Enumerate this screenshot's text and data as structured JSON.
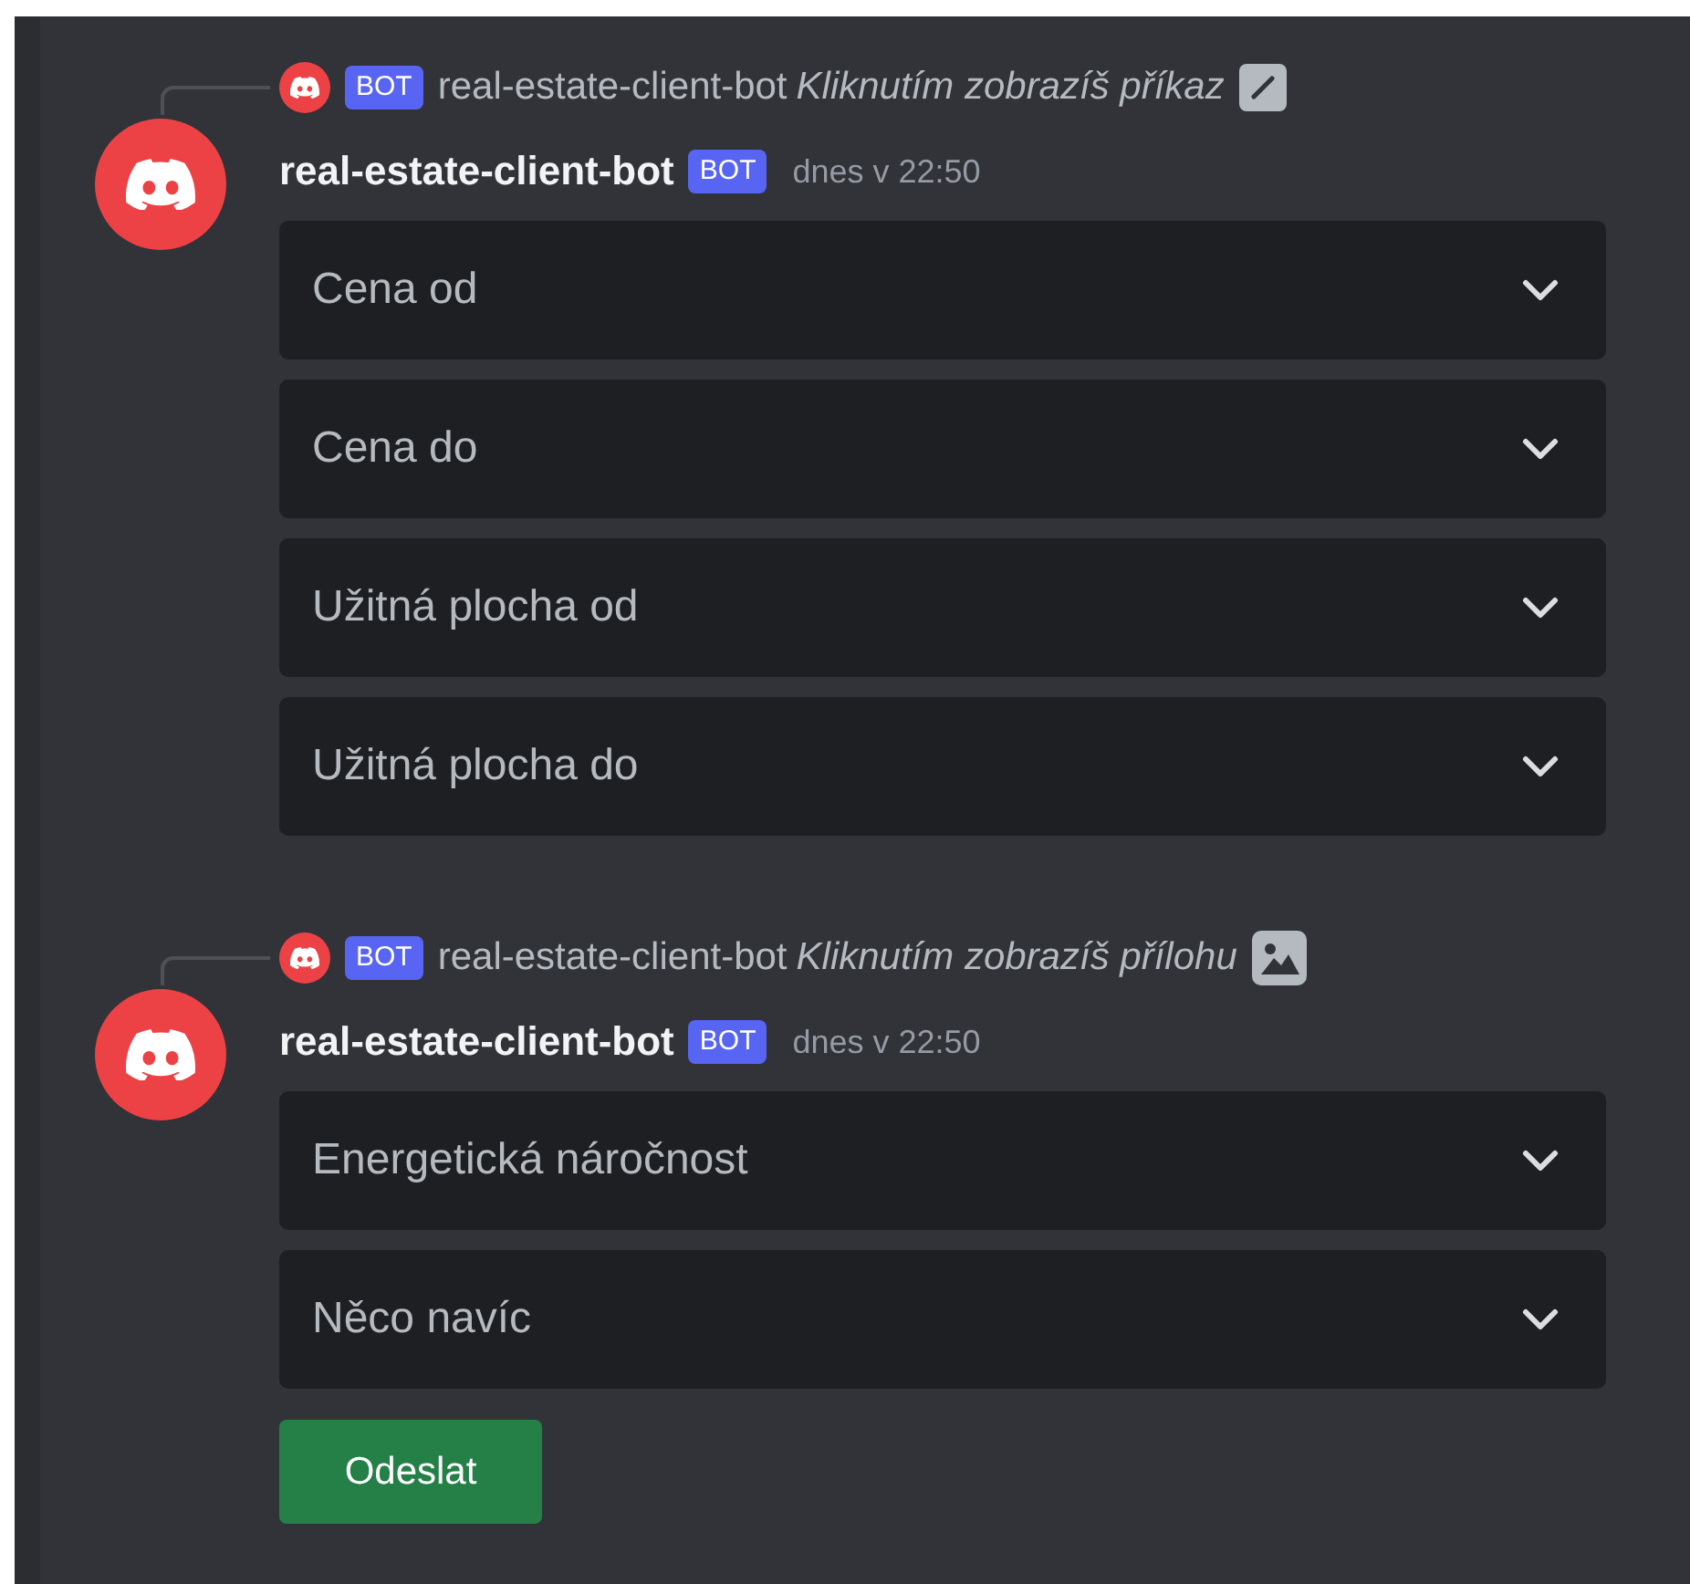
{
  "messages": [
    {
      "reply": {
        "author": "real-estate-client-bot",
        "badge": "BOT",
        "text": "Kliknutím zobrazíš příkaz",
        "kind": "command"
      },
      "author": "real-estate-client-bot",
      "badge": "BOT",
      "timestamp": "dnes v 22:50",
      "components": [
        {
          "kind": "select",
          "placeholder": "Cena od"
        },
        {
          "kind": "select",
          "placeholder": "Cena do"
        },
        {
          "kind": "select",
          "placeholder": "Užitná plocha od"
        },
        {
          "kind": "select",
          "placeholder": "Užitná plocha do"
        }
      ]
    },
    {
      "reply": {
        "author": "real-estate-client-bot",
        "badge": "BOT",
        "text": "Kliknutím zobrazíš přílohu",
        "kind": "image"
      },
      "author": "real-estate-client-bot",
      "badge": "BOT",
      "timestamp": "dnes v 22:50",
      "components": [
        {
          "kind": "select",
          "placeholder": "Energetická náročnost"
        },
        {
          "kind": "select",
          "placeholder": "Něco navíc"
        },
        {
          "kind": "button",
          "label": "Odeslat"
        }
      ]
    }
  ]
}
